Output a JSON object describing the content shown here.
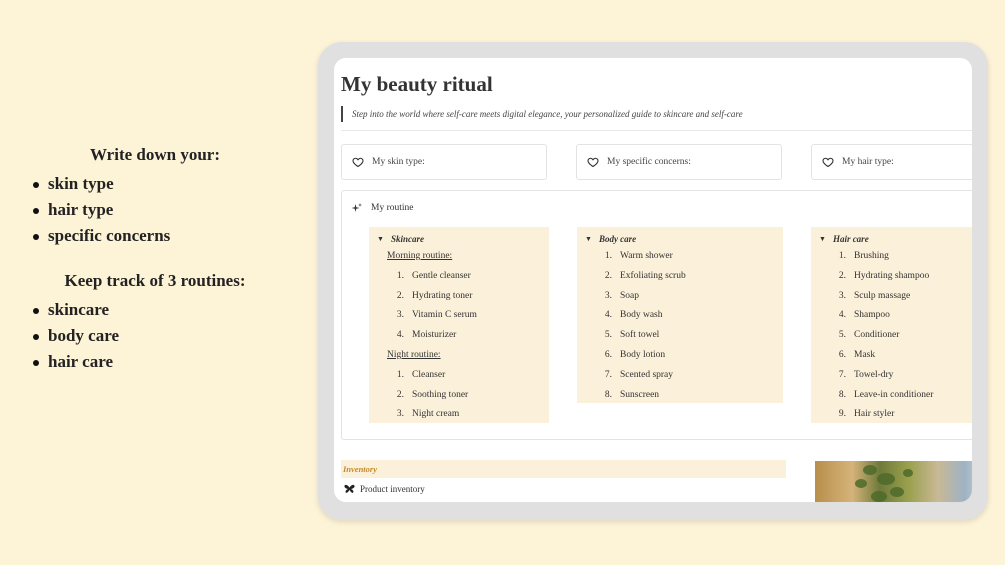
{
  "promo": {
    "heading1": "Write down your:",
    "list1": [
      "skin type",
      "hair type",
      "specific concerns"
    ],
    "heading2": "Keep track of 3 routines:",
    "list2": [
      "skincare",
      "body care",
      "hair care"
    ]
  },
  "page": {
    "title": "My beauty ritual",
    "quote": "Step into the world where self-care meets digital elegance, your personalized guide to skincare and self-care"
  },
  "attributes": {
    "skin_type": "My skin type:",
    "concerns": "My specific concerns:",
    "hair_type": "My hair type:"
  },
  "routine": {
    "heading": "My routine",
    "skincare": {
      "title": "Skincare",
      "morning_label": "Morning routine:",
      "morning": [
        "Gentle cleanser",
        "Hydrating toner",
        "Vitamin C serum",
        "Moisturizer"
      ],
      "night_label": "Night routine:",
      "night": [
        "Cleanser",
        "Soothing toner",
        "Night cream"
      ]
    },
    "bodycare": {
      "title": "Body care",
      "items": [
        "Warm shower",
        "Exfoliating scrub",
        "Soap",
        "Body wash",
        "Soft towel",
        "Body lotion",
        "Scented spray",
        "Sunscreen"
      ]
    },
    "haircare": {
      "title": "Hair care",
      "items": [
        "Brushing",
        "Hydrating shampoo",
        "Sculp massage",
        "Shampoo",
        "Conditioner",
        "Mask",
        "Towel-dry",
        "Leave-in conditioner",
        "Hair styler"
      ]
    }
  },
  "inventory": {
    "title": "Inventory",
    "link": "Product inventory"
  },
  "colors": {
    "background": "#fdf3d7",
    "toggle_bg": "#fbf0d9",
    "inventory_accent": "#c78a26"
  },
  "icons": [
    "heart-icon",
    "sparkle-icon",
    "toggle-triangle-icon",
    "butterfly-icon"
  ]
}
